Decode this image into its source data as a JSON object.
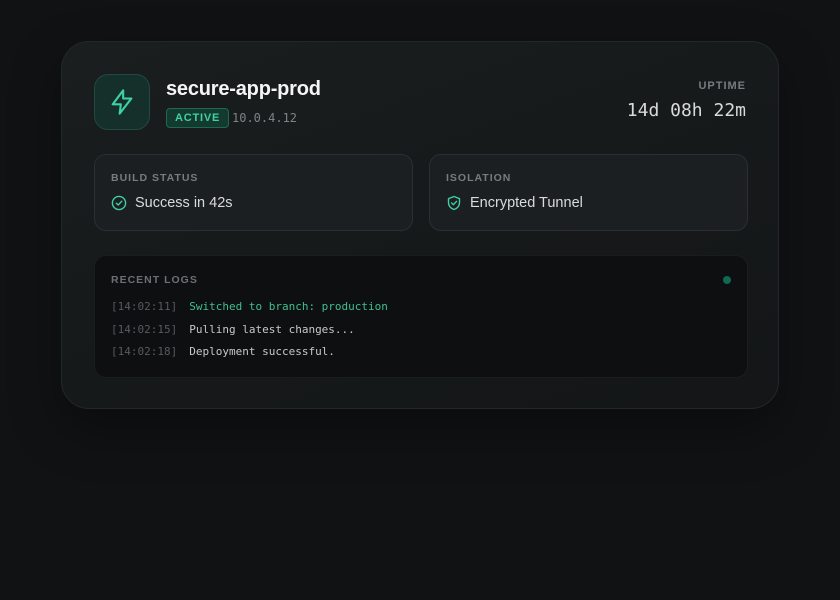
{
  "app": {
    "name": "secure-app-prod",
    "status": "ACTIVE",
    "ip": "10.0.4.12",
    "icon": "lightning-icon"
  },
  "uptime": {
    "label": "UPTIME",
    "value": "14d 08h 22m"
  },
  "build_status": {
    "label": "BUILD STATUS",
    "value": "Success in 42s",
    "icon": "check-circle-icon"
  },
  "isolation": {
    "label": "ISOLATION",
    "value": "Encrypted Tunnel",
    "icon": "shield-check-icon"
  },
  "logs": {
    "label": "RECENT LOGS",
    "lines": [
      {
        "time": "[14:02:11]",
        "message": "Switched to branch: production",
        "kind": "success"
      },
      {
        "time": "[14:02:15]",
        "message": "Pulling latest changes...",
        "kind": "normal"
      },
      {
        "time": "[14:02:18]",
        "message": "Deployment successful.",
        "kind": "normal"
      }
    ]
  },
  "colors": {
    "accent": "#3fd1a0",
    "background": "#111214",
    "card": "#181c1d"
  }
}
